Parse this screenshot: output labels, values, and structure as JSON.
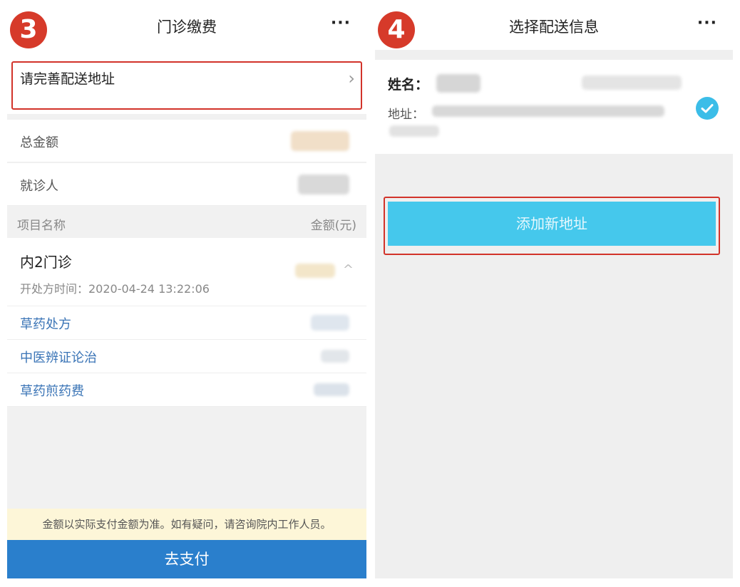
{
  "left_screen": {
    "step_number": "3",
    "header": {
      "title": "门诊缴费",
      "more": "···"
    },
    "address": {
      "label": "请完善配送地址",
      "chevron": "›"
    },
    "rows": [
      {
        "label": "总金额"
      },
      {
        "label": "就诊人"
      }
    ],
    "list_header": {
      "left": "项目名称",
      "right": "金额(元)"
    },
    "visit": {
      "title": "内2门诊",
      "time_label": "开处方时间：2020-04-24 13:22:06",
      "chevron": "^"
    },
    "items": [
      {
        "label": "草药处方"
      },
      {
        "label": "中医辨证论治"
      },
      {
        "label": "草药煎药费"
      }
    ],
    "notice": "金额以实际支付金额为准。如有疑问，请咨询院内工作人员。",
    "pay_button": "去支付",
    "colors": {
      "primary": "#2a7fcc",
      "link": "#3a74b6",
      "highlight": "#d2332a",
      "notice_bg": "#fdf6d8"
    }
  },
  "right_screen": {
    "step_number": "4",
    "header": {
      "title": "选择配送信息",
      "more": "···"
    },
    "address_card": {
      "name_label": "姓名：",
      "address_label": "地址：",
      "selected_icon": "check-circle-icon"
    },
    "add_button": "添加新地址",
    "colors": {
      "button": "#45c8ec",
      "check": "#3bbde8"
    }
  }
}
